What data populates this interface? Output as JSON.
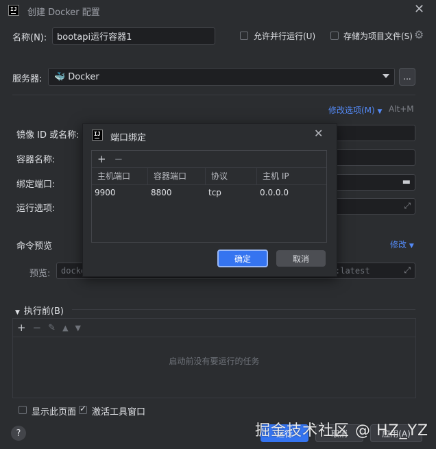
{
  "window": {
    "title": "创建 Docker 配置"
  },
  "form": {
    "name_label": "名称(N):",
    "name_value": "bootapi运行容器1",
    "allow_parallel_label": "允许并行运行(U)",
    "store_as_project_label": "存储为项目文件(S)",
    "server_label": "服务器:",
    "server_value": "Docker",
    "browse_label": "...",
    "modify_options_label": "修改选项(M)",
    "modify_options_shortcut": "Alt+M",
    "image_label": "镜像 ID 或名称:",
    "container_label": "容器名称:",
    "bind_ports_label": "绑定端口:",
    "run_options_label": "运行选项:",
    "command_preview_label": "命令预览",
    "modify_label": "修改",
    "preview_label": "预览:",
    "preview_value_start": "docke",
    "preview_value_end": ":latest"
  },
  "before_launch": {
    "title": "执行前(B)",
    "empty_text": "启动前没有要运行的任务"
  },
  "footer": {
    "show_page_label": "显示此页面",
    "activate_tool_window_label": "激活工具窗口",
    "help_label": "?",
    "run_label": "运行",
    "cancel_label": "取消",
    "apply_label": "应用(A)"
  },
  "port_dialog": {
    "title": "端口绑定",
    "columns": [
      "主机端口",
      "容器端口",
      "协议",
      "主机 IP"
    ],
    "rows": [
      {
        "host_port": "9900",
        "container_port": "8800",
        "protocol": "tcp",
        "host_ip": "0.0.0.0"
      }
    ],
    "ok_label": "确定",
    "cancel_label": "取消"
  },
  "watermark": "掘金技术社区 @ HZ_YZ",
  "colors": {
    "accent": "#3574f0",
    "link": "#548af7",
    "background": "#2b2d30",
    "field": "#1e1f22"
  }
}
